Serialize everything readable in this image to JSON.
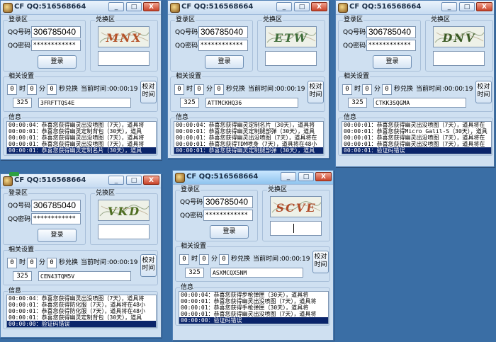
{
  "windows": [
    {
      "title": "CF  QQ:516568664",
      "controls": {
        "minimize": "_",
        "maximize": "□",
        "close": "X"
      },
      "login_group": "登录区",
      "qq_label": "QQ号码:",
      "qq_value": "306785040",
      "pw_label": "QQ密码:",
      "pw_value": "************",
      "login_button": "登录",
      "redeem_group": "兑换区",
      "captcha_text": "MNX",
      "captcha_input": "",
      "settings_group": "相关设置",
      "hour_value": "0",
      "hour_label": "时",
      "minute_value": "0",
      "minute_label": "分",
      "second_value": "0",
      "second_label": "秒兑换",
      "current_time_label": "当前时间",
      "current_time_value": ":00:00:19",
      "sync_button": "校对时间",
      "counter_value": "325",
      "code_value": "3FRFTTQS4E",
      "info_group": "信息",
      "log_lines": [
        "00:00:04：恭喜您获得幽灵出没喷图（7天），道具将",
        "00:00:01：恭喜您获得幽灵定制背包（30天），道具",
        "00:00:01：恭喜您获得幽灵出没喷图（7天），道具将",
        "00:00:01：恭喜您获得幽灵出没喷图（7天），道具将",
        "00:00:01：恭喜您获得幽灵定制名片（30天），道具"
      ],
      "selected_line": 4
    },
    {
      "title": "CF  QQ:516568664",
      "controls": {
        "minimize": "_",
        "maximize": "□",
        "close": "X"
      },
      "login_group": "登录区",
      "qq_label": "QQ号码:",
      "qq_value": "306785040",
      "pw_label": "QQ密码:",
      "pw_value": "************",
      "login_button": "登录",
      "redeem_group": "兑换区",
      "captcha_text": "ETW",
      "captcha_input": "",
      "settings_group": "相关设置",
      "hour_value": "0",
      "hour_label": "时",
      "minute_value": "0",
      "minute_label": "分",
      "second_value": "0",
      "second_label": "秒兑换",
      "current_time_label": "当前时间",
      "current_time_value": ":00:00:19",
      "sync_button": "校对时间",
      "counter_value": "325",
      "code_value": "ATTMCKHQ36",
      "info_group": "信息",
      "log_lines": [
        "00:00:04：恭喜您获得幽灵定制名片（30天），道具将",
        "00:00:01：恭喜您获得幽灵定制腿部弹（30天），道具",
        "00:00:01：恭喜您获得幽灵出没喷图（7天），道具将在",
        "00:00:01：恭喜您获得TDM喷身（7天），道具将在48小",
        "00:00:01：恭喜您获得幽灵定制腿部弹（30天），道具"
      ],
      "selected_line": 4
    },
    {
      "title": "CF  QQ:516568664",
      "controls": {
        "minimize": "_",
        "maximize": "□",
        "close": "X"
      },
      "login_group": "登录区",
      "qq_label": "QQ号码:",
      "qq_value": "306785040",
      "pw_label": "QQ密码:",
      "pw_value": "************",
      "login_button": "登录",
      "redeem_group": "兑换区",
      "captcha_text": "DNV",
      "captcha_input": "",
      "settings_group": "相关设置",
      "hour_value": "0",
      "hour_label": "时",
      "minute_value": "0",
      "minute_label": "分",
      "second_value": "0",
      "second_label": "秒兑换",
      "current_time_label": "当前时间",
      "current_time_value": ":00:00:19",
      "sync_button": "校对时间",
      "counter_value": "325",
      "code_value": "CTKK3SQGMA",
      "info_group": "信息",
      "log_lines": [
        "00:00:01：恭喜您获得幽灵出没喷图（7天），道具将在",
        "00:00:01：恭喜您获得Micro Galil-S（30天），道具",
        "00:00:01：恭喜您获得幽灵出没喷图（7天），道具将在",
        "00:00:01：恭喜您获得幽灵出没喷图（7天），道具将在",
        "00:00:01：验证码错误"
      ],
      "selected_line": 4
    },
    {
      "title": "CF  QQ:516568664",
      "controls": {
        "minimize": "_",
        "maximize": "□",
        "close": "X"
      },
      "login_group": "登录区",
      "qq_label": "QQ号码:",
      "qq_value": "306785040",
      "pw_label": "QQ密码:",
      "pw_value": "************",
      "login_button": "登录",
      "redeem_group": "兑换区",
      "captcha_text": "VKD",
      "captcha_input": "",
      "settings_group": "相关设置",
      "hour_value": "0",
      "hour_label": "时",
      "minute_value": "0",
      "minute_label": "分",
      "second_value": "0",
      "second_label": "秒兑换",
      "current_time_label": "当前时间",
      "current_time_value": ":00:00:19",
      "sync_button": "校对时间",
      "counter_value": "325",
      "code_value": "CEN43TQM5V",
      "info_group": "信息",
      "log_lines": [
        "00:00:04：恭喜您获得幽灵出没喷图（7天），道具将",
        "00:00:01：恭喜您获得防化服（7天），道具将在48小",
        "00:00:01：恭喜您获得防化服（7天），道具将在48小",
        "00:00:01：恭喜您获得幽灵定制背包（30天），道具",
        "00:00:00：验证码错误"
      ],
      "selected_line": 4
    },
    {
      "title": "CF  QQ:516568664",
      "controls": {
        "minimize": "_",
        "maximize": "□",
        "close": "X"
      },
      "login_group": "登录区",
      "qq_label": "QQ号码:",
      "qq_value": "306785040",
      "pw_label": "QQ密码:",
      "pw_value": "************",
      "login_button": "登录",
      "redeem_group": "兑换区",
      "captcha_text": "SCVE",
      "captcha_input": "",
      "settings_group": "相关设置",
      "hour_value": "0",
      "hour_label": "时",
      "minute_value": "0",
      "minute_label": "分",
      "second_value": "0",
      "second_label": "秒兑换",
      "current_time_label": "当前时间",
      "current_time_value": ":00:00:19",
      "sync_button": "校对时间",
      "counter_value": "325",
      "code_value": "ASXMCQX5NM",
      "info_group": "信息",
      "log_lines": [
        "00:00:04：恭喜您获得步枪弹匣（30天），道具将",
        "00:00:01：恭喜您获得幽灵出没喷图（7天），道具将",
        "00:00:01：恭喜您获得手枪弹匣（30天），道具将",
        "00:00:01：恭喜您获得幽灵出没喷图（7天），道具将",
        "00:00:00：验证码错误"
      ],
      "selected_line": 4
    }
  ],
  "colors": {
    "desktop": "#3a6ea5",
    "window_bg": "#cfe0f1",
    "selection": "#0a246a"
  }
}
